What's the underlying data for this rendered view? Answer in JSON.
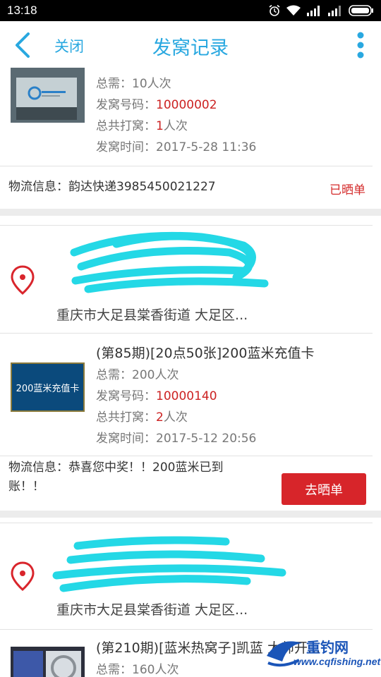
{
  "status_bar": {
    "time": "13:18"
  },
  "header": {
    "close_label": "关闭",
    "title": "发窝记录"
  },
  "labels": {
    "total_needed": "总需：",
    "number": "发窝号码：",
    "total_played": "总共打窝：",
    "time": "发窝时间：",
    "logistics": "物流信息："
  },
  "records": [
    {
      "total_needed": "10人次",
      "number": "10000002",
      "played_count": "1",
      "played_unit": "人次",
      "time": "2017-5-28 11:36",
      "logistics": "韵达快递3985450021227",
      "status": "已晒单"
    },
    {
      "address": "重庆市大足县棠香街道 大足区...",
      "title": "(第85期)[20点50张]200蓝米充值卡",
      "thumb_label": "200蓝米充值卡",
      "total_needed": "200人次",
      "number": "10000140",
      "played_count": "2",
      "played_unit": "人次",
      "time": "2017-5-12 20:56",
      "logistics": "恭喜您中奖！！200蓝米已到账！！",
      "action": "去晒单"
    },
    {
      "address": "重庆市大足县棠香街道 大足区...",
      "title": "(第210期)[蓝米热窝子]凯蓝 大师开...",
      "total_needed": "160人次"
    }
  ],
  "watermark": {
    "brand": "重钓网",
    "url": "www.cqfishing.net"
  },
  "colors": {
    "accent": "#29a8e0",
    "red": "#d42b2b",
    "button": "#d7252a"
  }
}
